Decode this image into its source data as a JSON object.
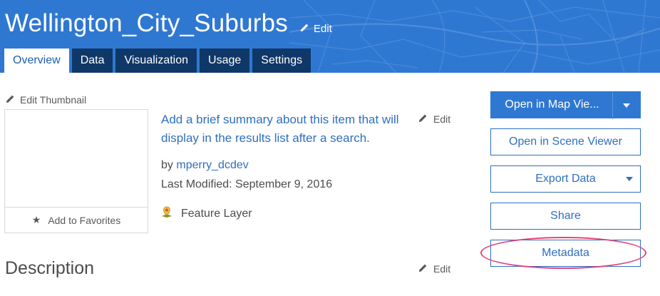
{
  "header": {
    "title": "Wellington_City_Suburbs",
    "edit_label": "Edit",
    "tabs": [
      {
        "label": "Overview",
        "active": true
      },
      {
        "label": "Data",
        "active": false
      },
      {
        "label": "Visualization",
        "active": false
      },
      {
        "label": "Usage",
        "active": false
      },
      {
        "label": "Settings",
        "active": false
      }
    ]
  },
  "thumbnail": {
    "edit_label": "Edit Thumbnail",
    "favorites_label": "Add to Favorites"
  },
  "summary": {
    "text": "Add a brief summary about this item that will display in the results list after a search.",
    "edit_label": "Edit",
    "by_prefix": "by",
    "owner": "mperry_dcdev",
    "last_modified": "Last Modified: September 9, 2016",
    "item_type": "Feature Layer"
  },
  "description": {
    "title": "Description",
    "edit_label": "Edit"
  },
  "actions": {
    "open_map_viewer": "Open in Map Vie...",
    "open_scene_viewer": "Open in Scene Viewer",
    "export_data": "Export Data",
    "share": "Share",
    "metadata": "Metadata"
  },
  "colors": {
    "header_blue": "#2f78d2",
    "tab_dark": "#0f3868",
    "link_blue": "#2e6fc0",
    "highlight_pink": "#e0457b"
  }
}
